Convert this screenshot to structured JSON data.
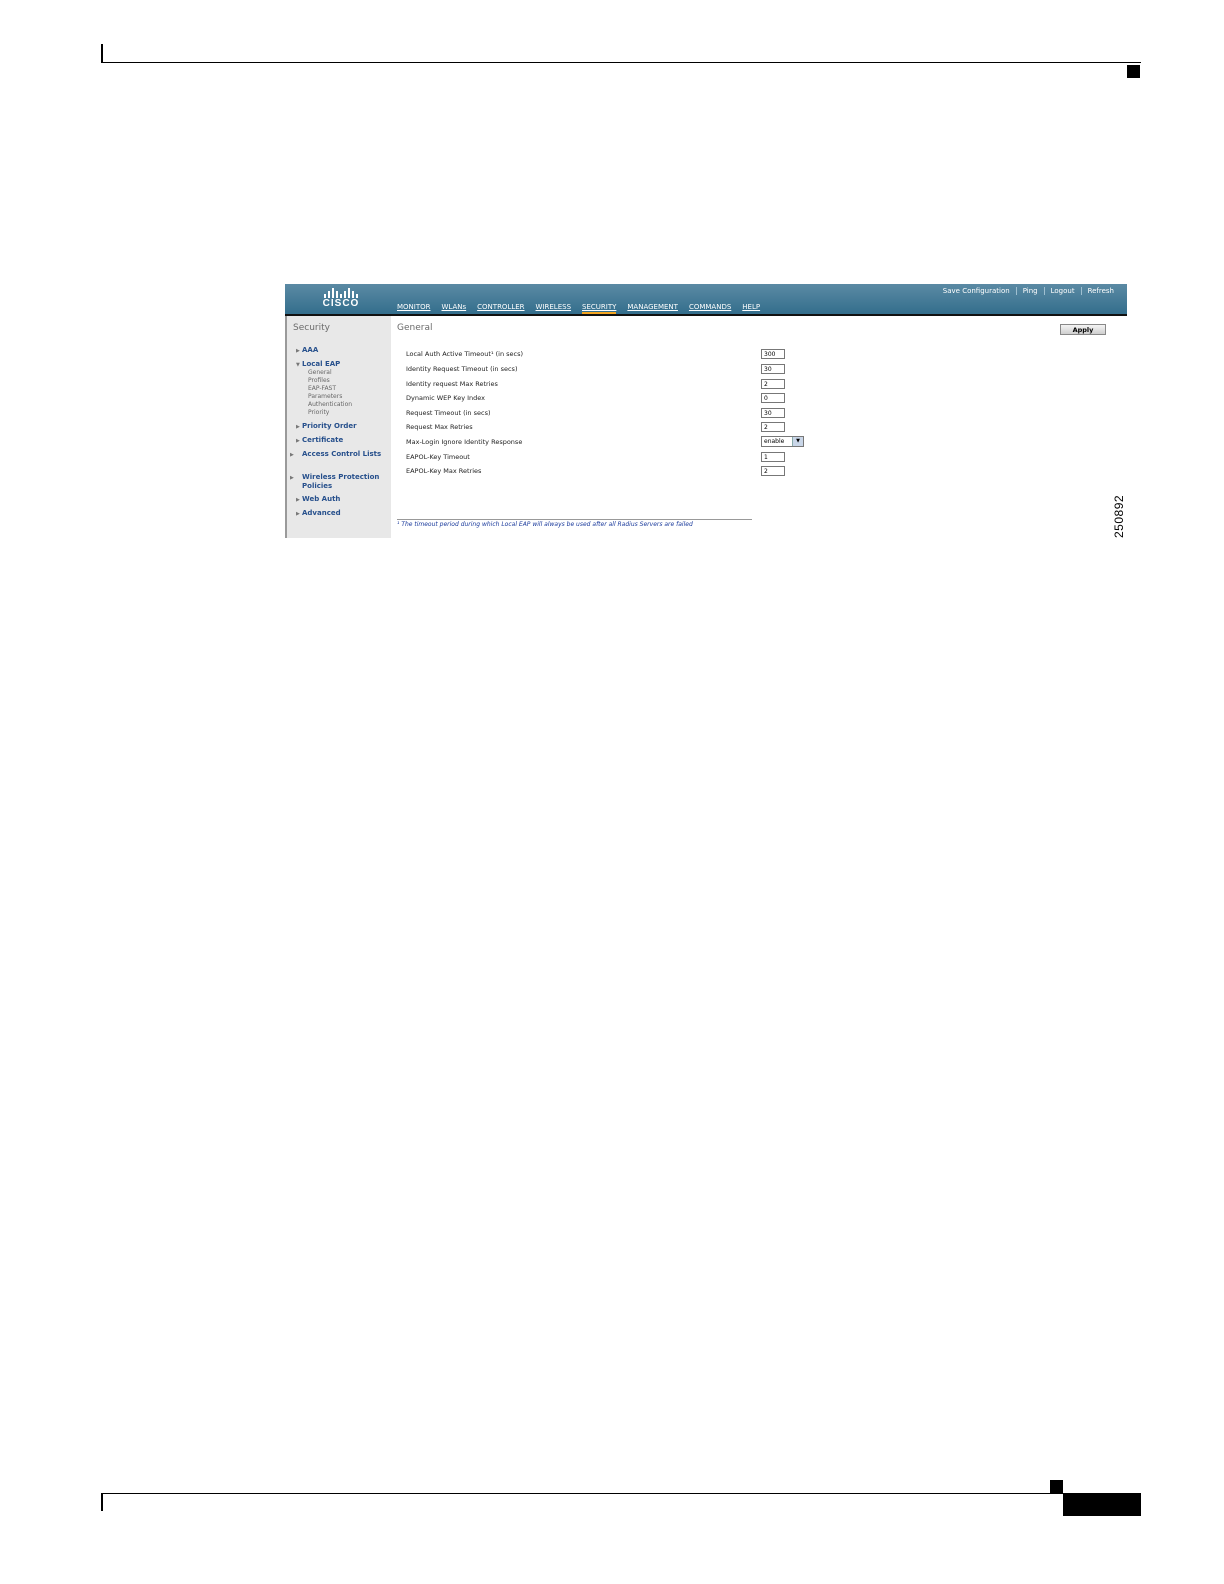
{
  "figure_id": "250892",
  "app": {
    "logo_text": "CISCO",
    "top_links": [
      "Save Configuration",
      "Ping",
      "Logout",
      "Refresh"
    ],
    "main_nav": [
      "MONITOR",
      "WLANs",
      "CONTROLLER",
      "WIRELESS",
      "SECURITY",
      "MANAGEMENT",
      "COMMANDS",
      "HELP"
    ],
    "active_nav": "SECURITY"
  },
  "sidebar": {
    "title": "Security",
    "items": [
      {
        "label": "AAA"
      },
      {
        "label": "Local EAP"
      },
      {
        "label": "Priority Order"
      },
      {
        "label": "Certificate"
      },
      {
        "label": "Access Control Lists"
      },
      {
        "label": "Wireless Protection Policies"
      },
      {
        "label": "Web Auth"
      },
      {
        "label": "Advanced"
      }
    ],
    "local_eap_subitems": [
      "General",
      "Profiles",
      "EAP-FAST",
      "Parameters",
      "Authentication",
      "Priority"
    ]
  },
  "main": {
    "title": "General",
    "apply_label": "Apply",
    "rows": [
      {
        "label": "Local Auth Active Timeout¹ (in secs)",
        "value": "300"
      },
      {
        "label": "Identity Request Timeout (in secs)",
        "value": "30"
      },
      {
        "label": "Identity request Max Retries",
        "value": "2"
      },
      {
        "label": "Dynamic WEP Key Index",
        "value": "0"
      },
      {
        "label": "Request Timeout (in secs)",
        "value": "30"
      },
      {
        "label": "Request Max Retries",
        "value": "2"
      },
      {
        "label": "Max-Login Ignore Identity Response",
        "value": "enable"
      },
      {
        "label": "EAPOL-Key Timeout",
        "value": "1"
      },
      {
        "label": "EAPOL-Key Max Retries",
        "value": "2"
      }
    ],
    "footnote": "¹ The timeout period during which Local EAP will always be used after all Radius Servers are failed"
  }
}
